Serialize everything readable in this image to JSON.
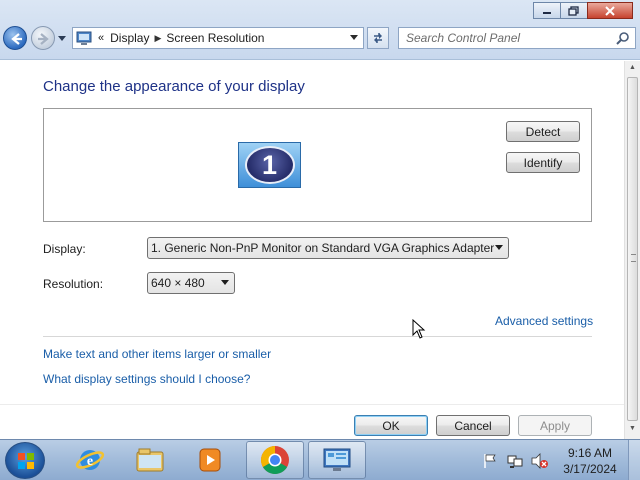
{
  "window": {
    "breadcrumb": [
      "Display",
      "Screen Resolution"
    ],
    "search_placeholder": "Search Control Panel"
  },
  "page": {
    "title": "Change the appearance of your display",
    "monitor_number": "1",
    "detect_label": "Detect",
    "identify_label": "Identify",
    "display_label": "Display:",
    "display_value": "1. Generic Non-PnP Monitor on Standard VGA Graphics Adapter",
    "resolution_label": "Resolution:",
    "resolution_value": "640 × 480",
    "advanced_link": "Advanced settings",
    "links": [
      "Make text and other items larger or smaller",
      "What display settings should I choose?"
    ],
    "ok_label": "OK",
    "cancel_label": "Cancel",
    "apply_label": "Apply"
  },
  "taskbar": {
    "pinned": [
      "start-orb",
      "internet-explorer-icon",
      "windows-explorer-icon",
      "media-player-icon",
      "chrome-icon",
      "control-panel-icon"
    ],
    "clock_time": "9:16 AM",
    "clock_date": "3/17/2024"
  },
  "colors": {
    "title_text": "#1e3287",
    "link_text": "#1a5ea8",
    "taskbar": "#a4bddb"
  }
}
